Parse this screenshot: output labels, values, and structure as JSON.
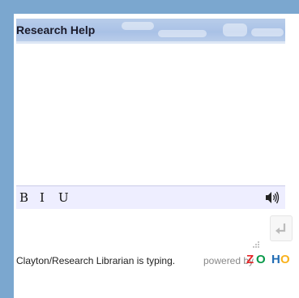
{
  "header": {
    "title": "Research Help"
  },
  "toolbar": {
    "bold_label": "B",
    "italic_label": "I",
    "underline_label": "U",
    "speaker_icon": "speaker-icon"
  },
  "input": {
    "value": "",
    "send_icon": "enter-icon"
  },
  "status": {
    "typing_text": "Clayton/Research Librarian is typing.",
    "powered_by": "powered by",
    "brand": {
      "z": "Z",
      "o1": "O",
      "h": "H",
      "o2": "O"
    },
    "brand_colors": {
      "z": "#e42527",
      "o1": "#089949",
      "h": "#226db4",
      "o2": "#f9b21d"
    }
  },
  "colors": {
    "background": "#7ba7cf",
    "header": "#a9c1e6",
    "toolbar": "#eeeeff"
  }
}
